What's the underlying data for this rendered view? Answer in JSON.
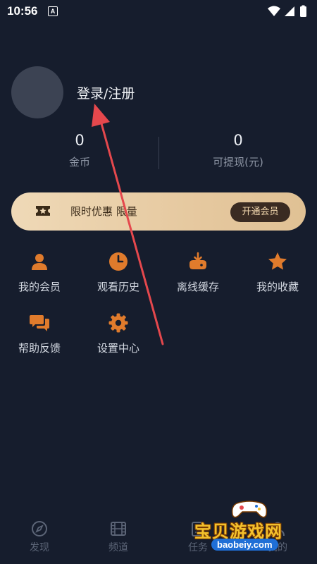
{
  "status_bar": {
    "time": "10:56",
    "a_badge": "A"
  },
  "profile": {
    "login_label": "登录/注册"
  },
  "stats": [
    {
      "value": "0",
      "label": "金币"
    },
    {
      "value": "0",
      "label": "可提现(元)"
    }
  ],
  "promo": {
    "text": "限时优惠 限量",
    "button_label": "开通会员"
  },
  "grid": [
    {
      "label": "我的会员",
      "icon": "user-icon"
    },
    {
      "label": "观看历史",
      "icon": "clock-icon"
    },
    {
      "label": "离线缓存",
      "icon": "download-icon"
    },
    {
      "label": "我的收藏",
      "icon": "star-icon"
    },
    {
      "label": "帮助反馈",
      "icon": "chat-icon"
    },
    {
      "label": "设置中心",
      "icon": "gear-icon"
    }
  ],
  "bottom_nav": [
    {
      "label": "发现",
      "icon": "compass-icon"
    },
    {
      "label": "频道",
      "icon": "film-icon"
    },
    {
      "label": "任务",
      "icon": "task-icon"
    },
    {
      "label": "我的",
      "icon": "profile-icon"
    }
  ],
  "watermark": {
    "main": "宝贝游戏网",
    "sub": "baobeiy.com"
  },
  "colors": {
    "background": "#161d2d",
    "accent": "#e07b2c",
    "promo_bg": "#ecd3ad",
    "arrow": "#e5484d"
  }
}
